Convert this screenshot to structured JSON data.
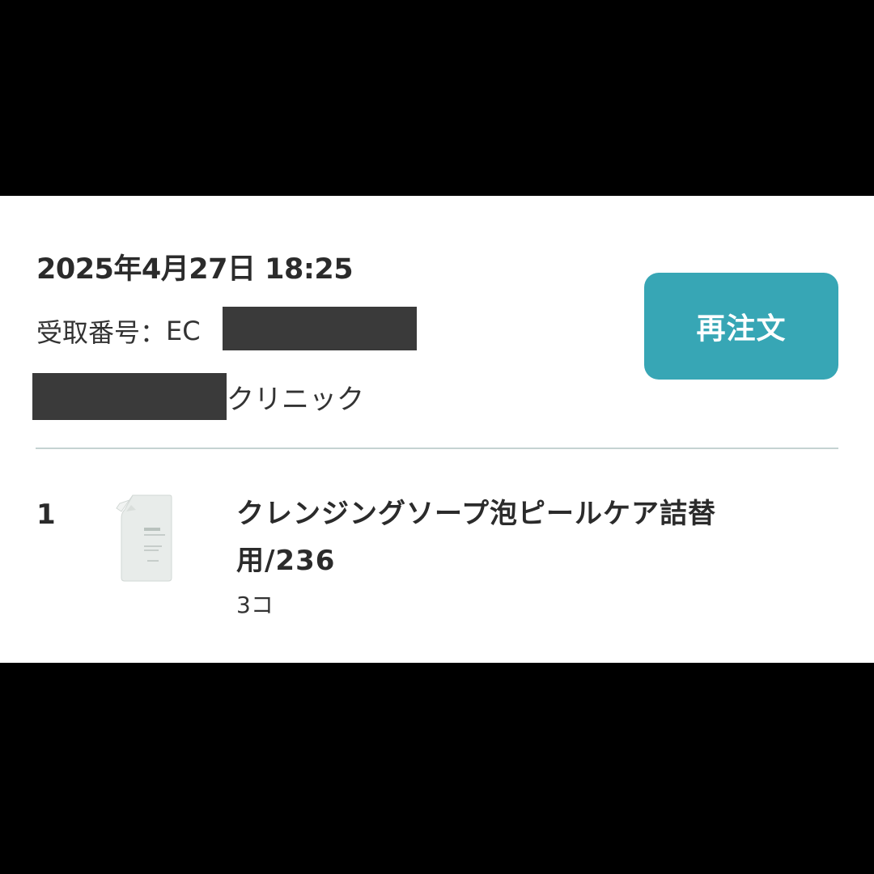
{
  "order": {
    "date": "2025年4月27日 18:25",
    "receipt_label": "受取番号：",
    "receipt_prefix": "EC",
    "clinic_suffix": "クリニック",
    "reorder_label": "再注文"
  },
  "items": [
    {
      "index": "1",
      "name": "クレンジングソープ泡ピールケア詰替用/236",
      "quantity": "3コ",
      "thumbnail_icon": "refill-pouch-icon"
    }
  ],
  "colors": {
    "accent": "#37a6b5",
    "divider": "#c5d3d2",
    "redaction": "#3a3a3a",
    "letterbox": "#000000"
  }
}
